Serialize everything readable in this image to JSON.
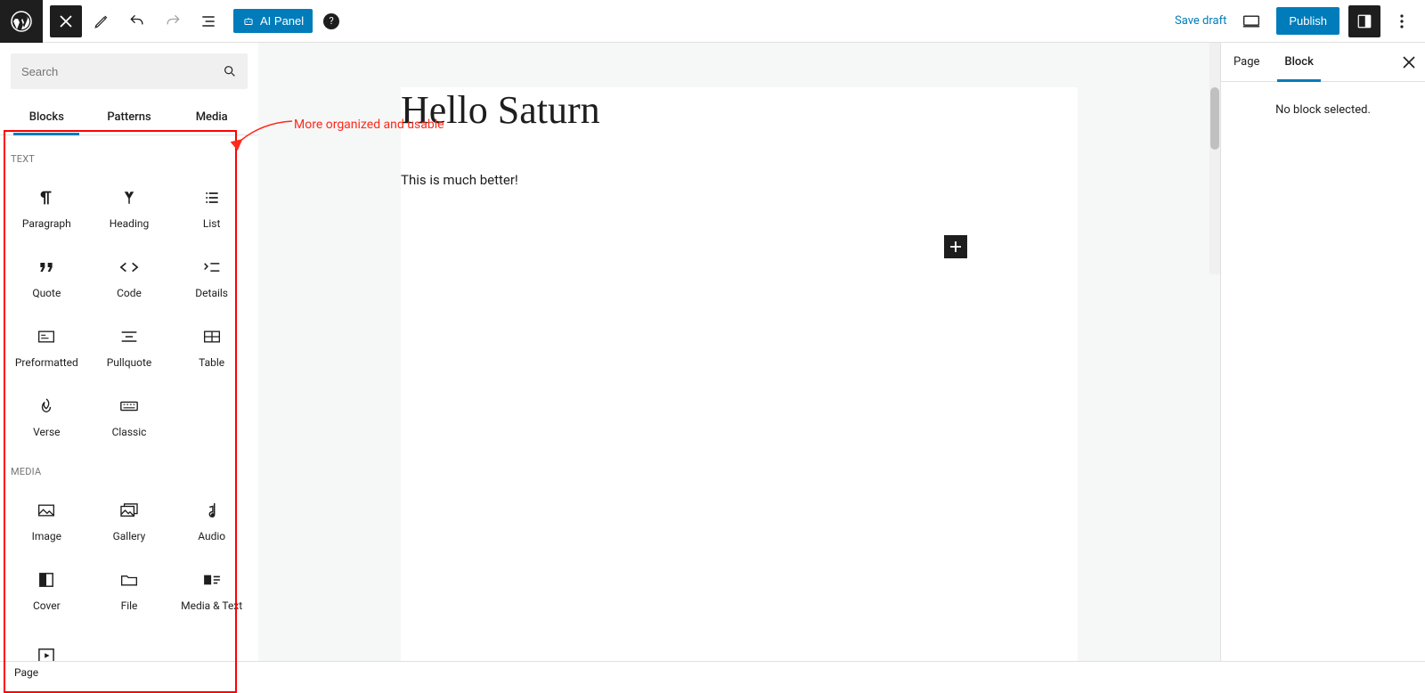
{
  "toolbar": {
    "ai_panel_label": "AI Panel",
    "save_draft_label": "Save draft",
    "publish_label": "Publish"
  },
  "inserter": {
    "search_placeholder": "Search",
    "tabs": {
      "blocks": "Blocks",
      "patterns": "Patterns",
      "media": "Media"
    },
    "sections": {
      "text": {
        "heading": "TEXT"
      },
      "media": {
        "heading": "MEDIA"
      }
    },
    "blocks": {
      "paragraph": "Paragraph",
      "heading": "Heading",
      "list": "List",
      "quote": "Quote",
      "code": "Code",
      "details": "Details",
      "preformatted": "Preformatted",
      "pullquote": "Pullquote",
      "table": "Table",
      "verse": "Verse",
      "classic": "Classic",
      "image": "Image",
      "gallery": "Gallery",
      "audio": "Audio",
      "cover": "Cover",
      "file": "File",
      "media_text": "Media & Text"
    }
  },
  "annotation": {
    "text": "More organized and usable"
  },
  "canvas": {
    "title": "Hello Saturn",
    "body": "This is much better!"
  },
  "sidebar": {
    "tabs": {
      "page": "Page",
      "block": "Block"
    },
    "no_block_text": "No block selected."
  },
  "footer": {
    "breadcrumb": "Page"
  }
}
